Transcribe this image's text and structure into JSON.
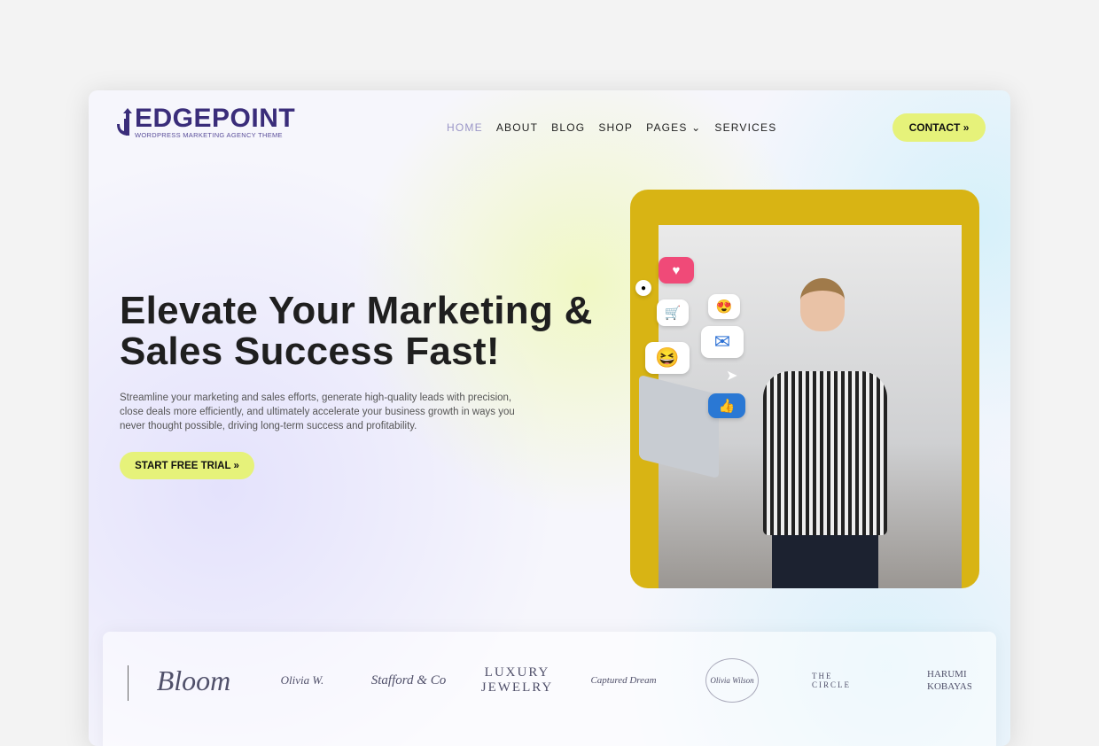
{
  "header": {
    "logo_title": "EDGEPOINT",
    "logo_tagline": "WORDPRESS MARKETING AGENCY THEME",
    "nav": [
      {
        "label": "HOME",
        "active": true
      },
      {
        "label": "ABOUT"
      },
      {
        "label": "BLOG"
      },
      {
        "label": "SHOP"
      },
      {
        "label": "PAGES ⌄"
      },
      {
        "label": "SERVICES"
      }
    ],
    "contact_label": "CONTACT »"
  },
  "hero": {
    "title": "Elevate Your Marketing & Sales Success Fast!",
    "description": "Streamline your marketing and sales efforts, generate high-quality leads with precision, close deals more efficiently, and ultimately accelerate your business growth in ways you never thought possible, driving long-term success and profitability.",
    "cta_label": "START FREE TRIAL »",
    "image_icons": [
      "heart-icon",
      "cart-icon",
      "heart-eyes-emoji-icon",
      "envelope-icon",
      "laughing-emoji-icon",
      "thumbs-up-icon",
      "location-pin-icon",
      "send-icon"
    ]
  },
  "client_logos": [
    "Bloom",
    "Olivia W.",
    "Stafford & Co",
    "LUXURY JEWELRY",
    "Captured Dream",
    "Olivia Wilson",
    "THE CIRCLE",
    "HARUMI KOBAYASHI"
  ],
  "colors": {
    "accent": "#e6f27a",
    "brand": "#3a2d7a",
    "image_frame": "#d8b414"
  }
}
